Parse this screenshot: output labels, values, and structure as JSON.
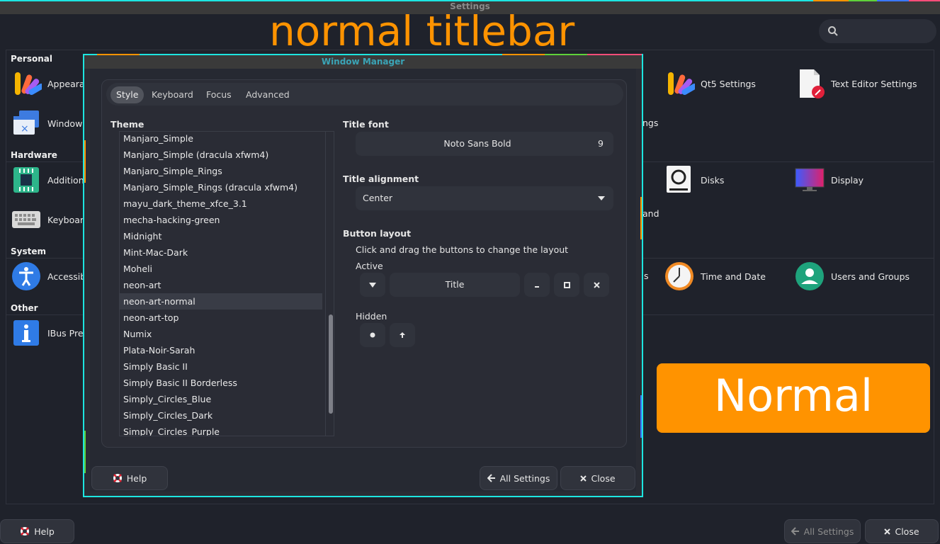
{
  "window": {
    "title": "Settings"
  },
  "overlay": {
    "heading": "normal titlebar",
    "badge": "Normal"
  },
  "search": {
    "placeholder": ""
  },
  "sections": {
    "personal": "Personal",
    "hardware": "Hardware",
    "system": "System",
    "other": "Other"
  },
  "personal_items": [
    {
      "label": "Appearan",
      "icon": "appearance-icon"
    },
    {
      "label": "Window M",
      "icon": "window-manager-icon"
    },
    {
      "label": "Qt5 Settings",
      "icon": "qt5-settings-icon"
    },
    {
      "label": "Text Editor Settings",
      "icon": "text-editor-icon"
    },
    {
      "label": "ngs",
      "icon": ""
    }
  ],
  "hardware_items": [
    {
      "label": "Additiona",
      "icon": "chip-icon"
    },
    {
      "label": "Keyboard",
      "icon": "keyboard-icon"
    },
    {
      "label": "Disks",
      "icon": "disks-icon"
    },
    {
      "label": "Display",
      "icon": "display-icon"
    },
    {
      "label": "and",
      "icon": ""
    }
  ],
  "system_items": [
    {
      "label": "Accessibi",
      "icon": "accessibility-icon"
    },
    {
      "label": "s",
      "icon": ""
    },
    {
      "label": "Time and Date",
      "icon": "clock-icon"
    },
    {
      "label": "Users and Groups",
      "icon": "users-icon"
    }
  ],
  "other_items": [
    {
      "label": "IBus Pref",
      "icon": "info-icon"
    }
  ],
  "footer": {
    "help": "Help",
    "all_settings": "All Settings",
    "close": "Close"
  },
  "wm": {
    "title": "Window Manager",
    "tabs": [
      "Style",
      "Keyboard",
      "Focus",
      "Advanced"
    ],
    "active_tab": "Style",
    "theme_heading": "Theme",
    "themes": [
      "Manjaro_Simple",
      "Manjaro_Simple (dracula xfwm4)",
      "Manjaro_Simple_Rings",
      "Manjaro_Simple_Rings (dracula xfwm4)",
      "mayu_dark_theme_xfce_3.1",
      "mecha-hacking-green",
      "Midnight",
      "Mint-Mac-Dark",
      "Moheli",
      "neon-art",
      "neon-art-normal",
      "neon-art-top",
      "Numix",
      "Plata-Noir-Sarah",
      "Simply Basic II",
      "Simply Basic II Borderless",
      "Simply_Circles_Blue",
      "Simply_Circles_Dark",
      "Simply_Circles_Purple"
    ],
    "selected_theme": "neon-art-normal",
    "title_font_heading": "Title font",
    "title_font_name": "Noto Sans Bold",
    "title_font_size": "9",
    "title_alignment_heading": "Title alignment",
    "title_alignment_value": "Center",
    "button_layout_heading": "Button layout",
    "button_layout_hint": "Click and drag the buttons to change the layout",
    "active_label": "Active",
    "title_button": "Title",
    "hidden_label": "Hidden",
    "help": "Help",
    "all_settings": "All Settings",
    "close": "Close"
  },
  "colors": {
    "accent_cyan": "#1de5e0",
    "accent_orange": "#ff9300",
    "background": "#1f222b"
  }
}
